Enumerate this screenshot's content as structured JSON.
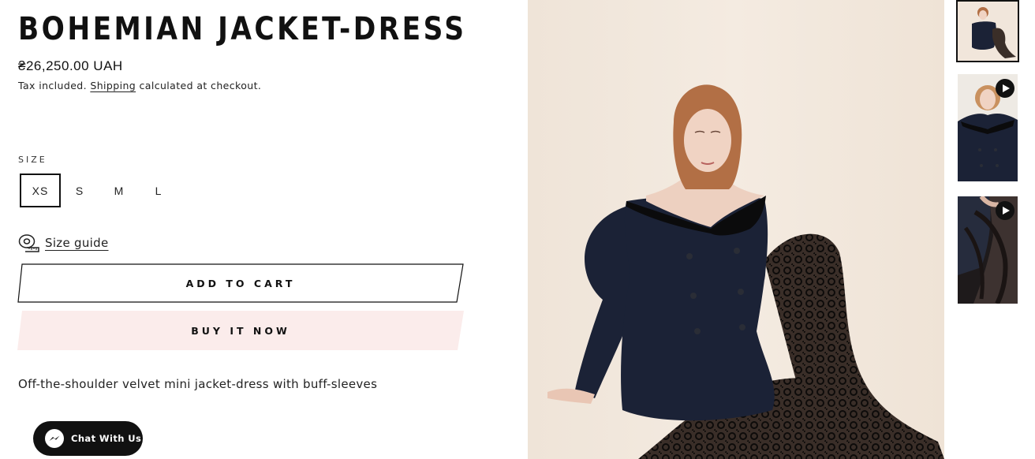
{
  "product": {
    "title": "BOHEMIAN JACKET-DRESS",
    "price": "₴26,250.00 UAH",
    "tax_prefix": "Tax included.",
    "shipping_link": "Shipping",
    "tax_suffix": "calculated at checkout."
  },
  "size": {
    "label": "SIZE",
    "options": [
      "XS",
      "S",
      "M",
      "L"
    ],
    "selected": "XS"
  },
  "size_guide": {
    "label": "Size guide",
    "icon": "measuring-tape-icon"
  },
  "buttons": {
    "add_to_cart": "ADD TO CART",
    "buy_now": "BUY IT NOW"
  },
  "description": "Off-the-shoulder velvet mini jacket-dress with buff-sleeves",
  "chat": {
    "label": "Chat With Us",
    "icon": "messenger-icon"
  },
  "gallery": {
    "thumbnails": [
      {
        "name": "thumbnail-1",
        "type": "image",
        "active": true
      },
      {
        "name": "thumbnail-2",
        "type": "video",
        "active": false
      },
      {
        "name": "thumbnail-3",
        "type": "video",
        "active": false
      }
    ]
  },
  "colors": {
    "text": "#111111",
    "buy_now_bg": "#fbeceb",
    "chat_bg": "#111111",
    "photo_bg": "#f2e7dc",
    "dress": "#1b2236"
  }
}
